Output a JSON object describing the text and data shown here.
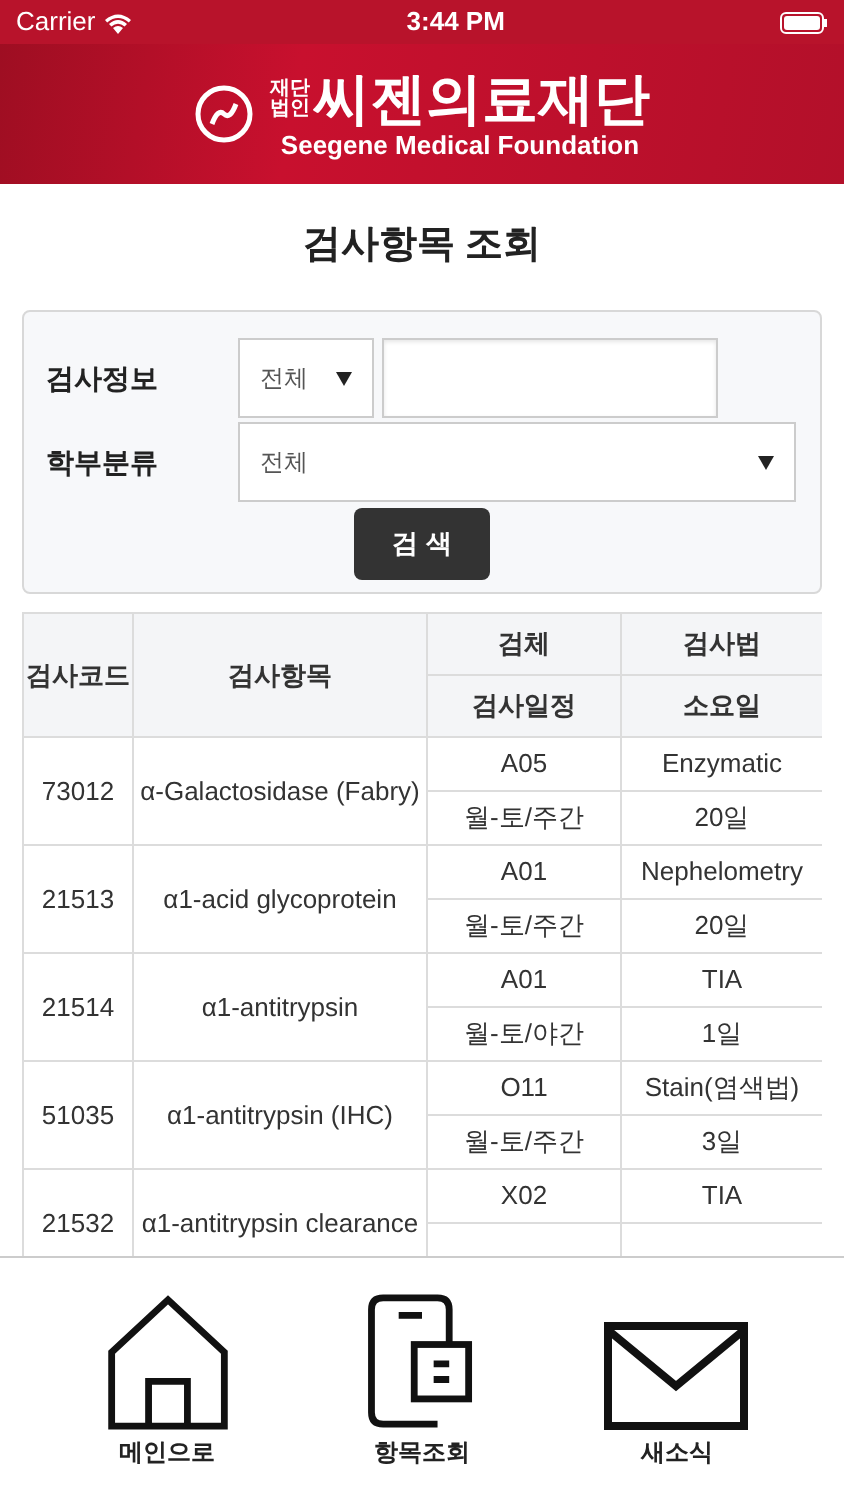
{
  "status_bar": {
    "carrier": "Carrier",
    "time": "3:44 PM"
  },
  "header": {
    "logo_prefix_top": "재단",
    "logo_prefix_bottom": "법인",
    "logo_name": "씨젠의료재단",
    "logo_english": "Seegene Medical Foundation"
  },
  "page_title": "검사항목 조회",
  "search_form": {
    "rows": [
      {
        "label": "검사정보",
        "kind": "select-input",
        "select_value": "전체"
      },
      {
        "label": "학부분류",
        "kind": "select",
        "select_value": "전체"
      }
    ],
    "button": "검 색"
  },
  "table": {
    "header_top": [
      "검사코드",
      "검사항목",
      "검체",
      "검사법"
    ],
    "header_bottom": [
      "검사일정",
      "소요일"
    ],
    "rows": [
      {
        "code": "73012",
        "item": "α-Galactosidase (Fabry)",
        "specimen": "A05",
        "method": "Enzymatic",
        "schedule": "월-토/주간",
        "days": "20일"
      },
      {
        "code": "21513",
        "item": "α1-acid glycoprotein",
        "specimen": "A01",
        "method": "Nephelometry",
        "schedule": "월-토/주간",
        "days": "20일"
      },
      {
        "code": "21514",
        "item": "α1-antitrypsin",
        "specimen": "A01",
        "method": "TIA",
        "schedule": "월-토/야간",
        "days": "1일"
      },
      {
        "code": "51035",
        "item": "α1-antitrypsin (IHC)",
        "specimen": "O11",
        "method": "Stain(염색법)",
        "schedule": "월-토/주간",
        "days": "3일"
      },
      {
        "code": "21532",
        "item": "α1-antitrypsin clearance",
        "specimen": "X02",
        "method": "TIA"
      }
    ]
  },
  "tab_bar": [
    {
      "label": "메인으로",
      "kind": "home"
    },
    {
      "label": "항목조회",
      "kind": "phone"
    },
    {
      "label": "새소식",
      "kind": "mail"
    }
  ]
}
